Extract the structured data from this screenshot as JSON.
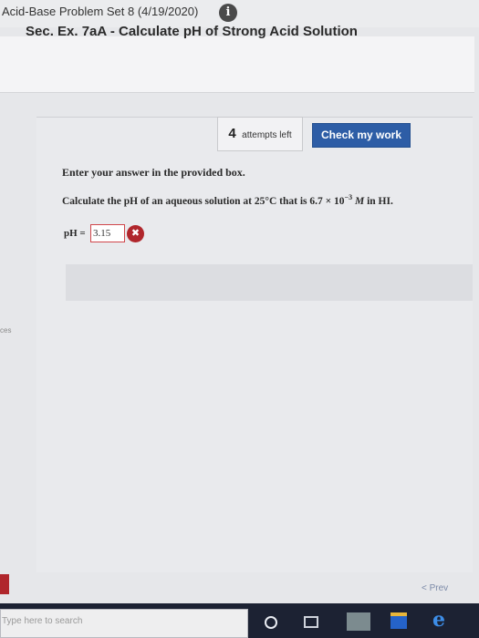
{
  "header": {
    "problem_set_title": "Acid-Base Problem Set 8 (4/19/2020)",
    "info_icon": "i",
    "exercise_title": "Sec. Ex. 7aA - Calculate pH of Strong Acid Solution"
  },
  "attempts": {
    "count": "4",
    "label": "attempts left"
  },
  "check_button_label": "Check my work",
  "problem": {
    "instruction": "Enter your answer in the provided box.",
    "question_before": "Calculate the pH of an aqueous solution at 25°C that is 6.7 × 10",
    "exponent": "−3",
    "unit": "M",
    "question_after": "in HI."
  },
  "answer": {
    "label": "pH =",
    "value": "3.15",
    "status_icon": "✖"
  },
  "side": {
    "left_edge_text": "ces"
  },
  "nav": {
    "prev_label": "< Prev"
  },
  "taskbar": {
    "search_placeholder": "Type here to search",
    "edge_glyph": "e"
  }
}
